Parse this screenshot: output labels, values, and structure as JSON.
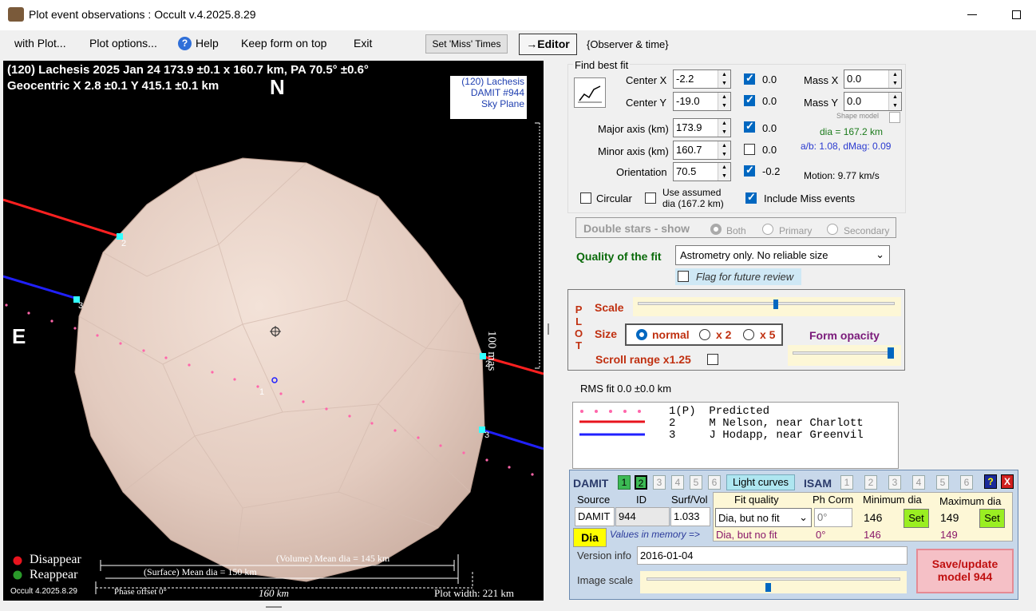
{
  "window": {
    "title": "Plot event observations : Occult v.4.2025.8.29"
  },
  "menu": {
    "with_plot": "with Plot...",
    "plot_options": "Plot options...",
    "help": "Help",
    "keep_on_top": "Keep form on top",
    "exit": "Exit",
    "set_miss": "Set 'Miss' Times",
    "editor": "→Editor",
    "observer_time": "{Observer & time}"
  },
  "plot": {
    "header_line1": "(120) Lachesis  2025 Jan 24   173.9 ±0.1 x 160.7 km, PA 70.5° ±0.6°",
    "header_line2": "Geocentric  X  2.8 ±0.1  Y 415.1 ±0.1 km",
    "north": "N",
    "east": "E",
    "info_name": "(120) Lachesis",
    "info_model": "DAMIT #944",
    "info_plane": "Sky Plane",
    "scale_label": "100 mas",
    "chord_2": "2",
    "chord_3": "3",
    "chord_1": "1",
    "disappear": "Disappear",
    "reappear": "Reappear",
    "volume_dia": "(Volume) Mean dia = 145 km",
    "surface_dia": "(Surface) Mean dia = 150 km",
    "version": "Occult 4.2025.8.29",
    "phase_offset": "Phase offset 0°",
    "km_scale": "160 km",
    "plot_width": "Plot width: 221 km",
    "colors": {
      "disappear": "#e8141e",
      "reappear": "#2a9a2a",
      "chord2": "#ff2020",
      "chord3": "#2020ff",
      "predicted": "#ff66aa"
    }
  },
  "fit": {
    "group": "Find best fit",
    "center_x_label": "Center X",
    "center_x": "-2.2",
    "center_x_unc": "0.0",
    "center_y_label": "Center Y",
    "center_y": "-19.0",
    "center_y_unc": "0.0",
    "major_label": "Major axis (km)",
    "major": "173.9",
    "major_unc": "0.0",
    "minor_label": "Minor axis (km)",
    "minor": "160.7",
    "minor_unc": "0.0",
    "orient_label": "Orientation",
    "orient": "70.5",
    "orient_unc": "-0.2",
    "mass_x_label": "Mass X",
    "mass_x": "0.0",
    "mass_y_label": "Mass Y",
    "mass_y": "0.0",
    "shape_model": "Shape model",
    "dia": "dia = 167.2 km",
    "ab": "a/b: 1.08, dMag: 0.09",
    "motion": "Motion: 9.77 km/s",
    "circular": "Circular",
    "use_assumed_1": "Use assumed",
    "use_assumed_2": "dia (167.2 km)",
    "include_miss": "Include Miss events",
    "double_stars": "Double stars - show",
    "both": "Both",
    "primary": "Primary",
    "secondary": "Secondary",
    "quality_label": "Quality of the fit",
    "quality_value": "Astrometry only. No reliable size",
    "flag_review": "Flag for future review"
  },
  "plotctl": {
    "vertical": [
      "P",
      "L",
      "O",
      "T"
    ],
    "scale": "Scale",
    "size": "Size",
    "normal": "normal",
    "x2": "x 2",
    "x5": "x 5",
    "form_opacity": "Form opacity",
    "scroll_range": "Scroll range x1.25",
    "rms": "RMS fit 0.0 ±0.0 km"
  },
  "legend": {
    "line1": "1(P)  Predicted",
    "line2": "2     M Nelson, near Charlott",
    "line3": "3     J Hodapp, near Greenvil"
  },
  "damit": {
    "title": "DAMIT",
    "nums": [
      "1",
      "2",
      "3",
      "4",
      "5",
      "6"
    ],
    "light_curves": "Light curves",
    "isam": "ISAM",
    "isam_nums": [
      "1",
      "2",
      "3",
      "4",
      "5",
      "6"
    ],
    "help": "?",
    "close": "X",
    "source_h": "Source",
    "id_h": "ID",
    "surfvol_h": "Surf/Vol",
    "fitq_h": "Fit quality",
    "phcorr_h": "Ph Corm",
    "mindia_h": "Minimum dia",
    "maxdia_h": "Maximum dia",
    "source": "DAMIT",
    "id": "944",
    "surfvol": "1.033",
    "fitq": "Dia, but no fit",
    "phcorr": "0°",
    "mindia": "146",
    "maxdia": "149",
    "set": "Set",
    "dia_btn": "Dia",
    "mem_label": "Values in memory =>",
    "mem_fitq": "Dia, but no fit",
    "mem_phcorr": "0°",
    "mem_min": "146",
    "mem_max": "149",
    "version_label": "Version info",
    "version": "2016-01-04",
    "image_scale": "Image scale",
    "save_1": "Save/update",
    "save_2": "model 944"
  }
}
